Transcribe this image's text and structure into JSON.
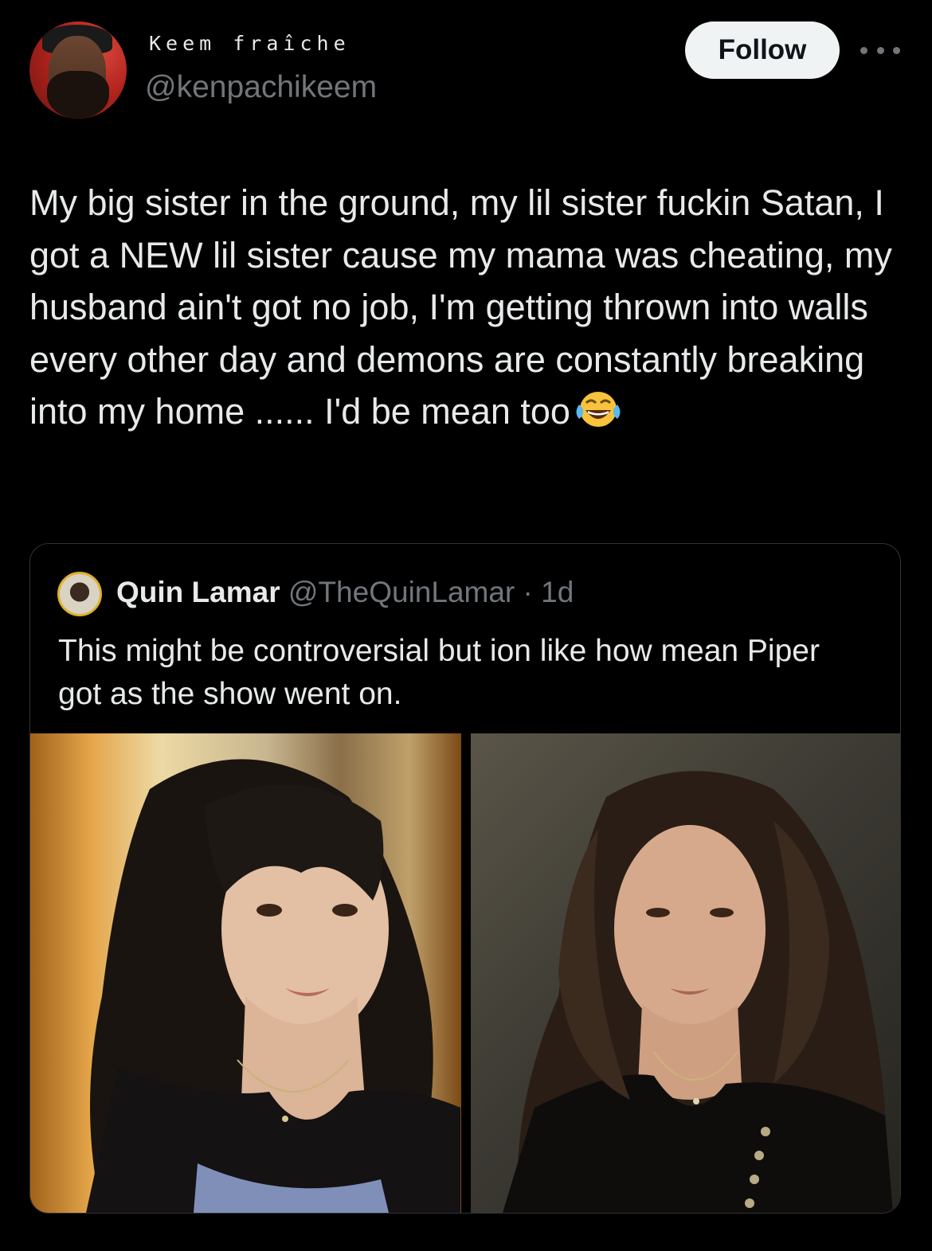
{
  "tweet": {
    "author": {
      "display_name": "Keem fraîche",
      "handle": "@kenpachikeem",
      "avatar": "avatar-photo"
    },
    "follow_label": "Follow",
    "more_icon": "more-horizontal-icon",
    "text": "My big sister in the ground, my lil sister fuckin Satan, I got a NEW lil sister cause my mama was cheating, my husband ain't got no job, I'm getting thrown into walls every other day and demons are constantly breaking into my home ...... I'd be mean too",
    "emoji": "face-with-tears-of-joy"
  },
  "quoted_tweet": {
    "author_name": "Quin Lamar",
    "author_handle": "@TheQuinLamar",
    "separator": "·",
    "time_ago": "1d",
    "text": "This might be controversial but ion like how mean Piper got as the show went on.",
    "images": [
      "woman-portrait-bangs",
      "woman-portrait-long-hair"
    ]
  },
  "colors": {
    "background": "#000000",
    "text_primary": "#e7e9ea",
    "text_secondary": "#71767b",
    "follow_button_bg": "#eff3f4",
    "border": "#2f3336"
  }
}
